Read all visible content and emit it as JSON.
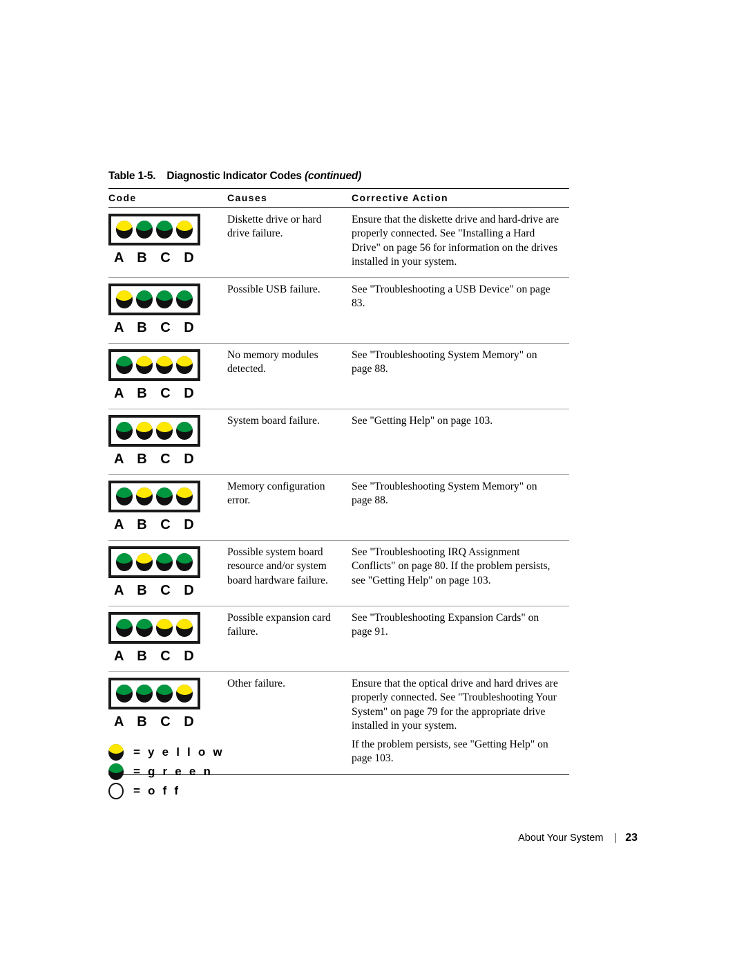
{
  "table": {
    "number_label": "Table 1-5.",
    "title": "Diagnostic Indicator Codes",
    "continued": "(continued)",
    "columns": {
      "code": "Code",
      "causes": "Causes",
      "action": "Corrective Action"
    },
    "indicator_labels": "A B C D",
    "rows": [
      {
        "leds": [
          "yellow",
          "green",
          "green",
          "yellow"
        ],
        "cause": "Diskette drive or hard drive failure.",
        "action": [
          "Ensure that the diskette drive and hard-drive are properly connected. See \"Installing a Hard Drive\" on page 56 for information on the drives installed in your system."
        ]
      },
      {
        "leds": [
          "yellow",
          "green",
          "green",
          "green"
        ],
        "cause": "Possible USB failure.",
        "action": [
          "See \"Troubleshooting a USB Device\" on page 83."
        ]
      },
      {
        "leds": [
          "green",
          "yellow",
          "yellow",
          "yellow"
        ],
        "cause": "No memory modules detected.",
        "action": [
          "See \"Troubleshooting System Memory\" on page 88."
        ]
      },
      {
        "leds": [
          "green",
          "yellow",
          "yellow",
          "green"
        ],
        "cause": "System board failure.",
        "action": [
          "See \"Getting Help\" on page 103."
        ]
      },
      {
        "leds": [
          "green",
          "yellow",
          "green",
          "yellow"
        ],
        "cause": "Memory configuration error.",
        "action": [
          "See \"Troubleshooting System Memory\" on page 88."
        ]
      },
      {
        "leds": [
          "green",
          "yellow",
          "green",
          "green"
        ],
        "cause": "Possible system board resource and/or system board hardware failure.",
        "action": [
          "See \"Troubleshooting IRQ Assignment Conflicts\" on page 80. If the problem persists, see \"Getting Help\" on page 103."
        ]
      },
      {
        "leds": [
          "green",
          "green",
          "yellow",
          "yellow"
        ],
        "cause": "Possible expansion card failure.",
        "action": [
          "See \"Troubleshooting Expansion Cards\" on page 91."
        ]
      },
      {
        "leds": [
          "green",
          "green",
          "green",
          "yellow"
        ],
        "cause": "Other failure.",
        "action": [
          "Ensure that the optical drive and hard drives are properly connected. See \"Troubleshooting Your System\" on page 79 for the appropriate drive installed in your system.",
          "If the problem persists, see \"Getting Help\" on page 103."
        ]
      }
    ]
  },
  "legend": [
    {
      "state": "yellow",
      "equals": "=",
      "label": "y e l l o w"
    },
    {
      "state": "green",
      "equals": "=",
      "label": "g r e e n"
    },
    {
      "state": "off",
      "equals": "=",
      "label": "o f f"
    }
  ],
  "footer": {
    "chapter": "About Your System",
    "separator": "|",
    "page_number": "23"
  },
  "colors": {
    "yellow": "#ffe800",
    "green": "#009640",
    "off": "#ffffff",
    "led_body": "#111111",
    "rule_dark": "#000000",
    "rule_light": "#9a9a9a"
  }
}
